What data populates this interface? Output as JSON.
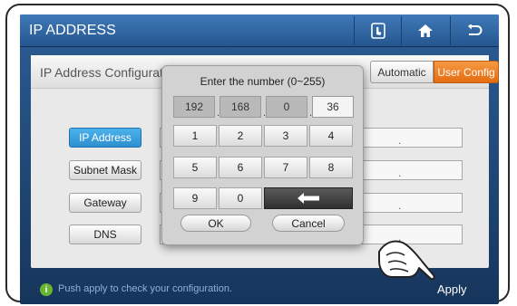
{
  "titlebar": {
    "title": "IP ADDRESS",
    "icons": [
      "touch-icon",
      "home-icon",
      "back-icon"
    ]
  },
  "panel": {
    "title": "IP Address Configuration",
    "mode_auto": "Automatic",
    "mode_user": "User Config",
    "fields": [
      {
        "label": "IP Address",
        "active": true,
        "value": "."
      },
      {
        "label": "Subnet Mask",
        "active": false,
        "value": "."
      },
      {
        "label": "Gateway",
        "active": false,
        "value": "."
      },
      {
        "label": "DNS",
        "active": false,
        "value": "."
      }
    ]
  },
  "keypad": {
    "prompt": "Enter the number (0~255)",
    "octets": [
      "192",
      "168",
      "0",
      "36"
    ],
    "separator": ".",
    "keys": [
      "1",
      "2",
      "3",
      "4",
      "5",
      "6",
      "7",
      "8",
      "9",
      "0"
    ],
    "ok": "OK",
    "cancel": "Cancel"
  },
  "status": {
    "icon": "info-icon",
    "message": "Push apply to check your configuration.",
    "apply": "Apply"
  },
  "colors": {
    "accent_orange": "#e46c10",
    "accent_blue": "#2d8fd0",
    "titlebar": "#2f6aa6",
    "status_green": "#69b530"
  }
}
